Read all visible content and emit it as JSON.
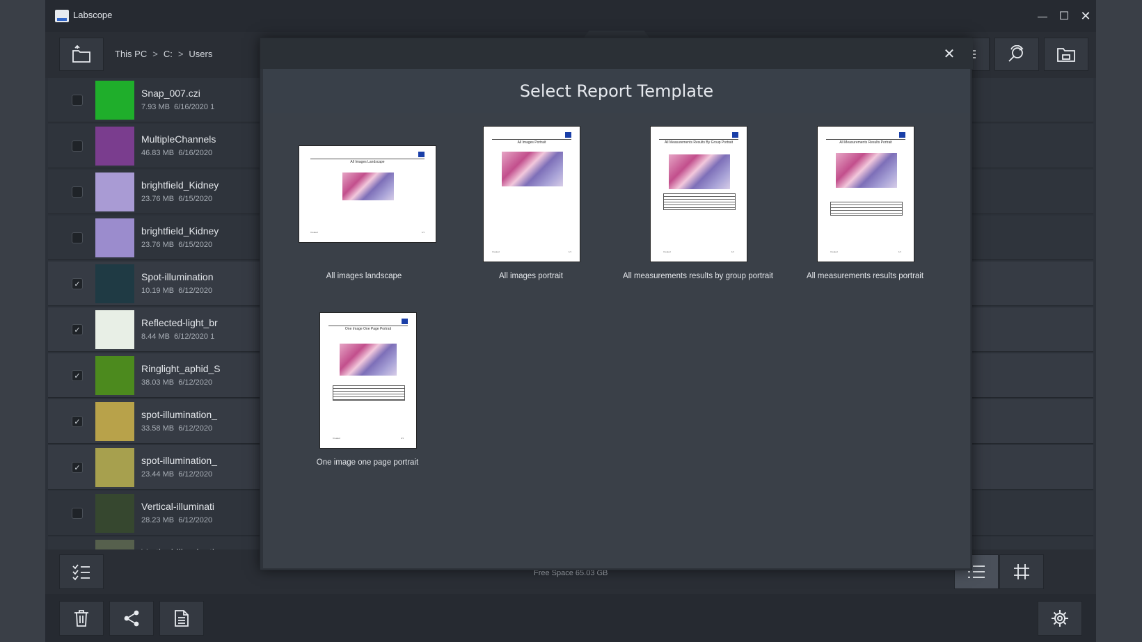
{
  "window": {
    "title": "Labscope",
    "controls": {
      "minimize": "—",
      "maximize": "☐",
      "close": "✕"
    }
  },
  "breadcrumb": {
    "items": [
      "This PC",
      "C:",
      "Users"
    ],
    "separator": ">"
  },
  "files": [
    {
      "name": "Snap_007.czi",
      "size": "7.93 MB",
      "date": "6/16/2020 1",
      "checked": false,
      "thumb_color": "#1fae2b"
    },
    {
      "name": "MultipleChannels",
      "size": "46.83 MB",
      "date": "6/16/2020",
      "checked": false,
      "thumb_color": "#7a3d8e"
    },
    {
      "name": "brightfield_Kidney",
      "size": "23.76 MB",
      "date": "6/15/2020",
      "checked": false,
      "thumb_color": "#a99bd4"
    },
    {
      "name": "brightfield_Kidney",
      "size": "23.76 MB",
      "date": "6/15/2020",
      "checked": false,
      "thumb_color": "#9b8ccd"
    },
    {
      "name": "Spot-illumination",
      "size": "10.19 MB",
      "date": "6/12/2020",
      "checked": true,
      "thumb_color": "#1f3a44"
    },
    {
      "name": "Reflected-light_br",
      "size": "8.44 MB",
      "date": "6/12/2020 1",
      "checked": true,
      "thumb_color": "#e8efe6"
    },
    {
      "name": "Ringlight_aphid_S",
      "size": "38.03 MB",
      "date": "6/12/2020",
      "checked": true,
      "thumb_color": "#4c8a1e"
    },
    {
      "name": "spot-illumination_",
      "size": "33.58 MB",
      "date": "6/12/2020",
      "checked": true,
      "thumb_color": "#b8a24a"
    },
    {
      "name": "spot-illumination_",
      "size": "23.44 MB",
      "date": "6/12/2020",
      "checked": true,
      "thumb_color": "#a7a04e"
    },
    {
      "name": "Vertical-illuminati",
      "size": "28.23 MB",
      "date": "6/12/2020",
      "checked": false,
      "thumb_color": "#36472f"
    },
    {
      "name": "Vertical-illuminati",
      "size": "",
      "date": "",
      "checked": false,
      "thumb_color": "#56604d"
    }
  ],
  "status": {
    "free_space": "Free Space  65.03 GB"
  },
  "modal": {
    "title": "Select Report Template",
    "close": "✕",
    "templates": [
      {
        "label": "All images landscape",
        "page_title": "All Images Landscape"
      },
      {
        "label": "All images portrait",
        "page_title": "All Images Portrait"
      },
      {
        "label": "All measurements results by group portrait",
        "page_title": "All Measurements Results By Group Portrait"
      },
      {
        "label": "All measurements results portrait",
        "page_title": "All Measurements Results Portrait"
      },
      {
        "label": "One image one page portrait",
        "page_title": "One Image One Page Portrait"
      }
    ]
  },
  "colors": {
    "accent": "#3467c8",
    "background": "#2c3139",
    "modal": "#3a4048"
  },
  "icons": {
    "toolbar": [
      "folder-up-icon",
      "sort-icon",
      "search-refresh-icon",
      "folder-location-icon"
    ],
    "bottom": [
      "checklist-icon",
      "list-view-icon",
      "grid-view-icon",
      "trash-icon",
      "share-icon",
      "report-icon",
      "settings-icon"
    ]
  }
}
